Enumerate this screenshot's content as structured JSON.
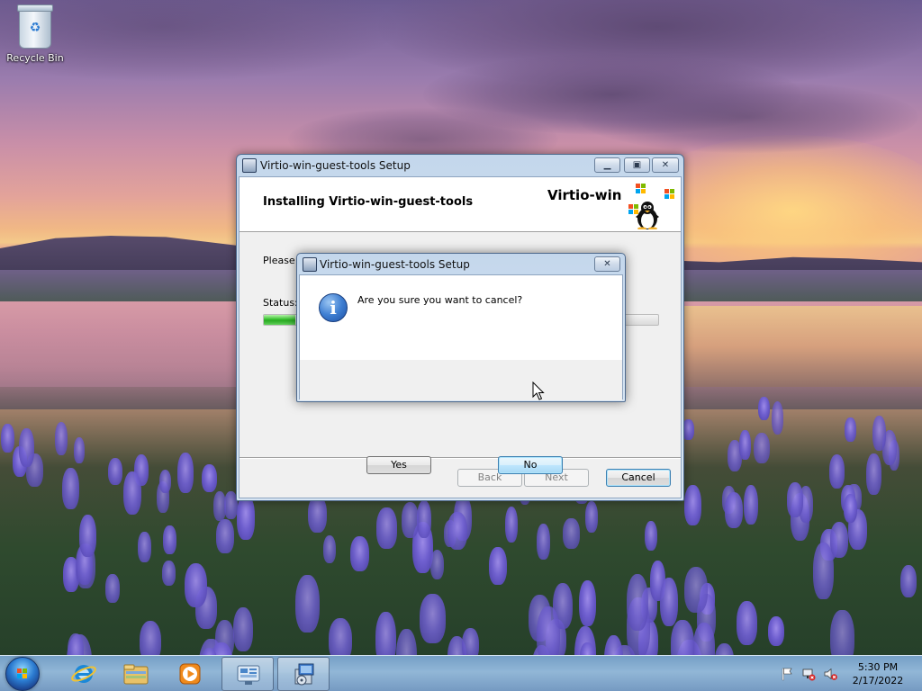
{
  "desktop": {
    "icons": [
      {
        "label": "Recycle Bin",
        "icon": "recycle-bin-icon"
      }
    ]
  },
  "setup_window": {
    "title": "Virtio-win-guest-tools Setup",
    "heading": "Installing Virtio-win-guest-tools",
    "brand": "Virtio-win",
    "please_text": "Please w",
    "status_label": "Status:",
    "progress": 0.08,
    "buttons": {
      "back": "Back",
      "next": "Next",
      "cancel": "Cancel"
    }
  },
  "confirm_dialog": {
    "title": "Virtio-win-guest-tools Setup",
    "message": "Are you sure you want to cancel?",
    "icon": "info-icon",
    "yes": "Yes",
    "no": "No"
  },
  "taskbar": {
    "pinned": [
      "internet-explorer-icon",
      "file-explorer-icon",
      "media-player-icon",
      "server-manager-icon",
      "setup-installer-icon"
    ],
    "tray": [
      "action-center-flag-icon",
      "network-icon",
      "volume-muted-icon"
    ],
    "clock": {
      "time": "5:30 PM",
      "date": "2/17/2022"
    }
  },
  "colors": {
    "accent": "#3c7fb1",
    "progress_green": "#37c12f",
    "window_frame": "#c4d7ec"
  }
}
